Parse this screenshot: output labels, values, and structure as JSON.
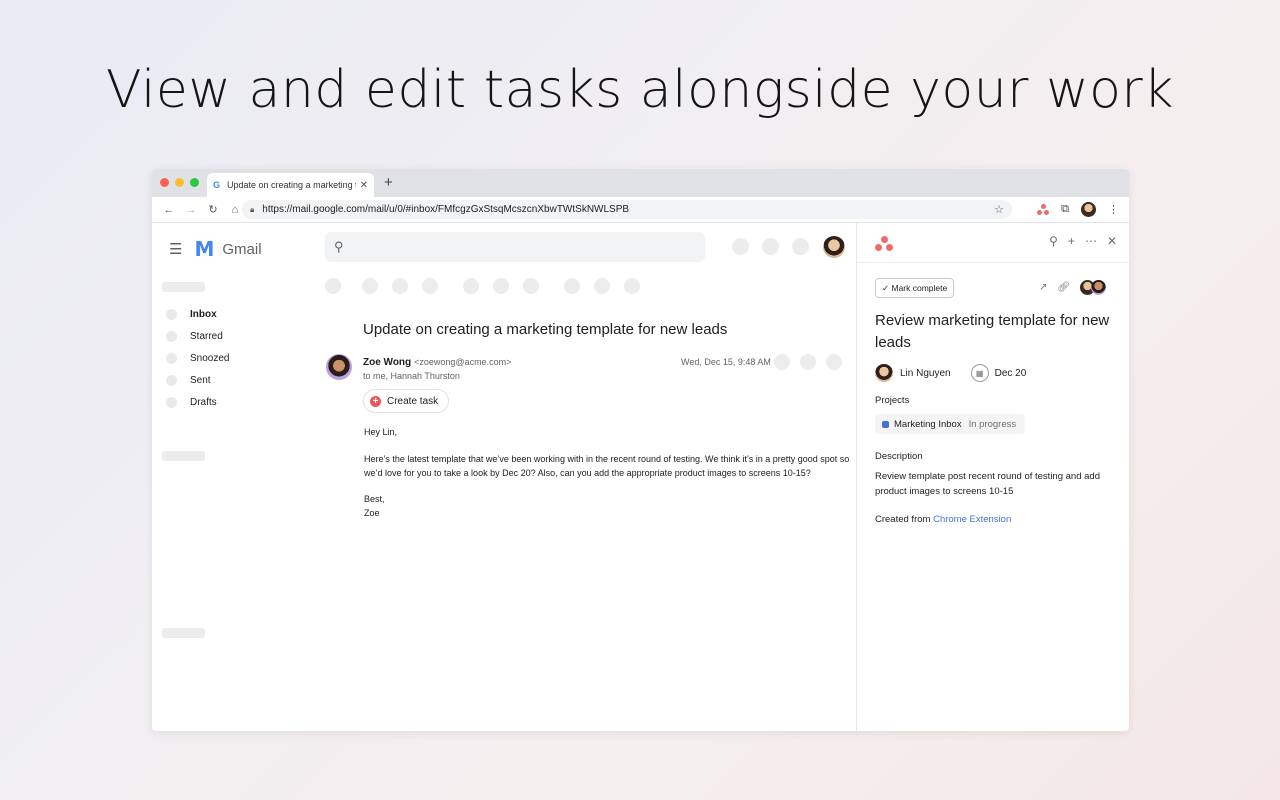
{
  "headline": "View and edit tasks alongside your work",
  "browser": {
    "traffic_lights": [
      "#ff5f57",
      "#febc2e",
      "#28c840"
    ],
    "tab_title": "Update on creating a marketing t",
    "tab_favicon": "G",
    "tab_close": "✕",
    "new_tab": "+",
    "url": "https://mail.google.com/mail/u/0/#inbox/FMfcgzGxStsqMcszcnXbwTWtSkNWLSPB"
  },
  "gmail": {
    "app_name": "Gmail",
    "sidebar": [
      {
        "label": "Inbox",
        "active": true
      },
      {
        "label": "Starred",
        "active": false
      },
      {
        "label": "Snoozed",
        "active": false
      },
      {
        "label": "Sent",
        "active": false
      },
      {
        "label": "Drafts",
        "active": false
      }
    ],
    "email": {
      "subject": "Update on creating a marketing template for new leads",
      "from_name": "Zoe Wong",
      "from_email": "<zoewong@acme.com>",
      "to": "to me, Hannah Thurston",
      "date": "Wed, Dec 15, 9:48 AM",
      "create_task_label": "Create task",
      "body": [
        "Hey Lin,",
        "Here’s the latest template that we’ve been working with in the recent round of testing. We think it’s in a pretty good spot so",
        "we’d love for you to take a look by Dec 20? Also, can you add the appropriate product images to screens 10-15?",
        "Best,",
        "Zoe"
      ]
    }
  },
  "asana": {
    "brand_color": "#f06a6a",
    "mark_complete": "✓ Mark complete",
    "task_title": "Review marketing template for new leads",
    "assignee": "Lin Nguyen",
    "due_date": "Dec 20",
    "projects_label": "Projects",
    "project_name": "Marketing Inbox",
    "project_color": "#4573d2",
    "project_status": "In progress",
    "description_label": "Description",
    "description": "Review template post recent round of testing and add product images to screens 10-15",
    "created_from_prefix": "Created from",
    "created_from_link": "Chrome Extension"
  }
}
